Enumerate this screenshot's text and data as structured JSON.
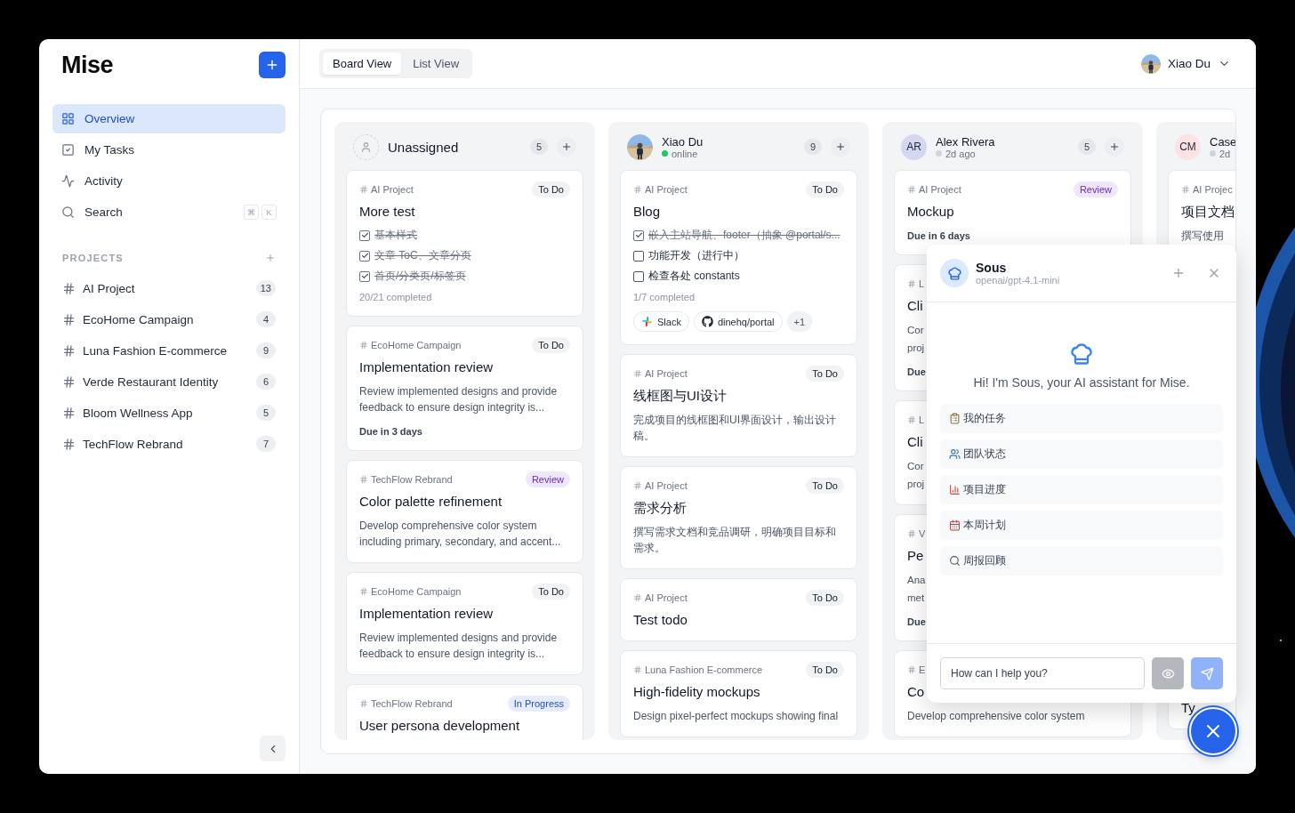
{
  "app": {
    "logo": "Mise"
  },
  "sidebar": {
    "nav": [
      {
        "label": "Overview",
        "selected": true
      },
      {
        "label": "My Tasks",
        "selected": false
      },
      {
        "label": "Activity",
        "selected": false
      },
      {
        "label": "Search",
        "selected": false,
        "shortcut": [
          "⌘",
          "K"
        ]
      }
    ],
    "projects_heading": "PROJECTS",
    "projects": [
      {
        "name": "AI Project",
        "count": "13"
      },
      {
        "name": "EcoHome Campaign",
        "count": "4"
      },
      {
        "name": "Luna Fashion E-commerce",
        "count": "9"
      },
      {
        "name": "Verde Restaurant Identity",
        "count": "6"
      },
      {
        "name": "Bloom Wellness App",
        "count": "5"
      },
      {
        "name": "TechFlow Rebrand",
        "count": "7"
      }
    ]
  },
  "topbar": {
    "views": [
      {
        "label": "Board View",
        "selected": true
      },
      {
        "label": "List View",
        "selected": false
      }
    ],
    "user": {
      "name": "Xiao Du"
    }
  },
  "columns": [
    {
      "kind": "unassigned",
      "name": "Unassigned",
      "count": "5",
      "cards": [
        {
          "project": "AI Project",
          "status": "To Do",
          "color": "#111827",
          "title": "More test",
          "checklist": [
            {
              "text": "基本样式",
              "checked": true
            },
            {
              "text": "文章 ToC、文章分页",
              "checked": true
            },
            {
              "text": "首页/分类页/标签页",
              "checked": true
            }
          ],
          "progress": "20/21 completed"
        },
        {
          "project": "EcoHome Campaign",
          "status": "To Do",
          "color": "#111827",
          "title": "Implementation review",
          "description": "Review implemented designs and provide feedback to ensure design integrity is...",
          "due": "Due in 3 days"
        },
        {
          "project": "TechFlow Rebrand",
          "status": "Review",
          "color": "#6d28d9",
          "title": "Color palette refinement",
          "description": "Develop comprehensive color system including primary, secondary, and accent..."
        },
        {
          "project": "EcoHome Campaign",
          "status": "To Do",
          "color": "#111827",
          "title": "Implementation review",
          "description": "Review implemented designs and provide feedback to ensure design integrity is..."
        },
        {
          "project": "TechFlow Rebrand",
          "status": "In Progress",
          "color": "#1d4ed8",
          "title": "User persona development"
        }
      ]
    },
    {
      "name": "Xiao Du",
      "presence": "online",
      "online": true,
      "count": "9",
      "cards": [
        {
          "project": "AI Project",
          "status": "To Do",
          "color": "#111827",
          "title": "Blog",
          "checklist": [
            {
              "text": "嵌入主站导航、footer（抽象 @portal/s...",
              "checked": true
            },
            {
              "text": "功能开发（进行中）",
              "checked": false
            },
            {
              "text": "检查各处 constants",
              "checked": false
            }
          ],
          "progress": "1/7 completed",
          "chips": [
            {
              "kind": "slack",
              "label": "Slack"
            },
            {
              "kind": "github",
              "label": "dinehq/portal"
            },
            {
              "kind": "more",
              "label": "+1"
            }
          ]
        },
        {
          "project": "AI Project",
          "status": "To Do",
          "color": "#111827",
          "title": "线框图与UI设计",
          "description": "完成项目的线框图和UI界面设计，输出设计稿。"
        },
        {
          "project": "AI Project",
          "status": "To Do",
          "color": "#111827",
          "title": "需求分析",
          "description": "撰写需求文档和竞品调研，明确项目目标和需求。"
        },
        {
          "project": "AI Project",
          "status": "To Do",
          "color": "#111827",
          "title": "Test todo"
        },
        {
          "project": "Luna Fashion E-commerce",
          "status": "To Do",
          "color": "#111827",
          "title": "High-fidelity mockups",
          "description": "Design pixel-perfect mockups showing final"
        }
      ]
    },
    {
      "kind": "initials",
      "initials": "AR",
      "color": "#d5d6f0",
      "name": "Alex Rivera",
      "presence": "2d ago",
      "online": false,
      "count": "5",
      "cards": [
        {
          "project": "AI Project",
          "status": "Review",
          "color": "#6d28d9",
          "title": "Mockup",
          "due": "Due in 6 days"
        },
        {
          "project": "L",
          "title": "Cli",
          "description_lines": [
            "Cor",
            "proj"
          ],
          "due": "Due"
        },
        {
          "project": "L",
          "title": "Cli",
          "description_lines": [
            "Cor",
            "proj"
          ]
        },
        {
          "project": "V",
          "title": "Pe",
          "description_lines": [
            "Ana",
            "met"
          ],
          "due": "Due"
        },
        {
          "project": "E",
          "title": "Co",
          "description": "Develop comprehensive color system"
        }
      ]
    },
    {
      "kind": "initials",
      "initials": "CM",
      "color": "#fbe3e3",
      "name": "Case",
      "presence": "2d",
      "online": false,
      "cards": [
        {
          "project": "AI Projec",
          "title": "项目文档",
          "description": "撰写使用"
        },
        {
          "title": "Ty"
        }
      ]
    }
  ],
  "assistant": {
    "name": "Sous",
    "model": "openai/gpt-4.1-mini",
    "greeting": "Hi! I'm Sous, your AI assistant for Mise.",
    "suggestions": [
      "我的任务",
      "团队状态",
      "项目进度",
      "本周计划",
      "周报回顾"
    ],
    "input": {
      "placeholder": "How can I help you?"
    }
  }
}
